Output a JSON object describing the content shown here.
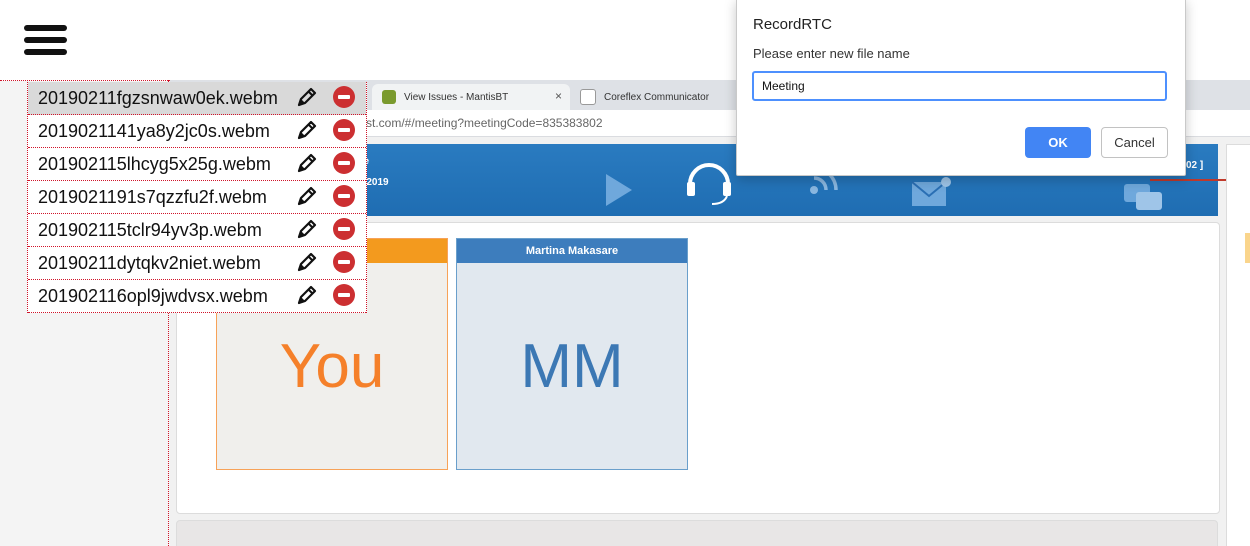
{
  "browser": {
    "tabs": [
      {
        "label": "View Issues - MantisBT",
        "close": "×"
      },
      {
        "label": "Coreflex Communicator"
      }
    ],
    "address": "test.com/#/meeting?meetingCode=835383802"
  },
  "banner": {
    "text_top": "ae",
    "text_date": "1 2019",
    "text_right": "02 ]"
  },
  "participants": [
    {
      "header": "",
      "initials": "You"
    },
    {
      "header": "Martina Makasare",
      "initials": "MM"
    }
  ],
  "files": [
    "20190211fgzsnwaw0ek.webm",
    "2019021141ya8y2jc0s.webm",
    "201902115lhcyg5x25g.webm",
    "2019021191s7qzzfu2f.webm",
    "201902115tclr94yv3p.webm",
    "20190211dytqkv2niet.webm",
    "201902116opl9jwdvsx.webm"
  ],
  "dialog": {
    "title": "RecordRTC",
    "message": "Please enter new file name",
    "input_value": "Meeting",
    "ok_label": "OK",
    "cancel_label": "Cancel"
  },
  "icons": {
    "menu": "hamburger-menu-icon",
    "edit": "pencil-icon",
    "delete": "minus-circle-icon"
  },
  "colors": {
    "accent_blue": "#4285f4",
    "delete_red": "#cc2f31",
    "divider_red": "#d0142a",
    "you_orange": "#f39a1e",
    "mm_blue": "#3d7dbd"
  }
}
